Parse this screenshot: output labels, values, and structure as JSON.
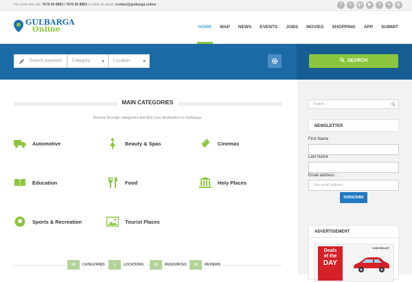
{
  "topbar": {
    "info_prefix": "For more info call:",
    "phones": "7676 80 8883 / 7676 80 8883",
    "info_mid": "or write an email:",
    "email": "contact@gulbarga.online",
    "social_icons": [
      "facebook-icon",
      "twitter-icon",
      "google-plus-icon",
      "youtube-icon",
      "tumblr-icon",
      "tripadvisor-icon",
      "instagram-icon"
    ],
    "social_glyphs": [
      "f",
      "t",
      "g+",
      "▶",
      "t",
      "∞",
      "◎"
    ]
  },
  "logo": {
    "line1": "GULBARGA",
    "line2": "Online"
  },
  "nav": {
    "items": [
      {
        "label": "HOME",
        "active": true
      },
      {
        "label": "MAP",
        "active": false
      },
      {
        "label": "NEWS",
        "active": false
      },
      {
        "label": "EVENTS",
        "active": false
      },
      {
        "label": "JOBS",
        "active": false
      },
      {
        "label": "MOVIES",
        "active": false
      },
      {
        "label": "SHOPPING",
        "active": false
      },
      {
        "label": "APP",
        "active": false
      },
      {
        "label": "SUBMIT",
        "active": false
      }
    ]
  },
  "search": {
    "keyword_placeholder": "Search keyword",
    "category_value": "Category",
    "location_value": "Location",
    "button_label": "SEARCH"
  },
  "main": {
    "title": "MAIN CATEGORIES",
    "subtitle": "Browse through categories and find your destination in Gulbarga.",
    "categories": [
      {
        "label": "Automotive",
        "icon": "truck-icon"
      },
      {
        "label": "Beauty & Spas",
        "icon": "woman-icon"
      },
      {
        "label": "Cinemas",
        "icon": "ticket-icon"
      },
      {
        "label": "Education",
        "icon": "book-icon"
      },
      {
        "label": "Food",
        "icon": "fork-knife-icon"
      },
      {
        "label": "Holy Places",
        "icon": "temple-icon"
      },
      {
        "label": "Sports & Recreation",
        "icon": "ball-icon"
      },
      {
        "label": "Tourist Places",
        "icon": "picture-icon"
      }
    ],
    "stats": [
      {
        "num": "59",
        "label": "CATEGORIES"
      },
      {
        "num": "1",
        "label": "LOCATIONS"
      },
      {
        "num": "12",
        "label": "RESOURCES"
      },
      {
        "num": "10",
        "label": "REVIEWS"
      }
    ]
  },
  "sidebar": {
    "search_placeholder": "Search...",
    "newsletter": {
      "title": "NEWSLETTER",
      "first_name_label": "First Name",
      "last_name_label": "Last Name",
      "email_label": "Email address :",
      "email_placeholder": "Your email address",
      "subscribe_label": "SUBSCRIBE"
    },
    "advertisement": {
      "title": "ADVERTISEMENT",
      "ad_line1": "Deals",
      "ad_line2": "of the",
      "ad_line3": "DAY",
      "ad_brand": "CHEVROLET"
    }
  },
  "colors": {
    "brand_blue": "#1b6aa5",
    "accent_green": "#8cc63f",
    "link_blue": "#4aa8db"
  }
}
